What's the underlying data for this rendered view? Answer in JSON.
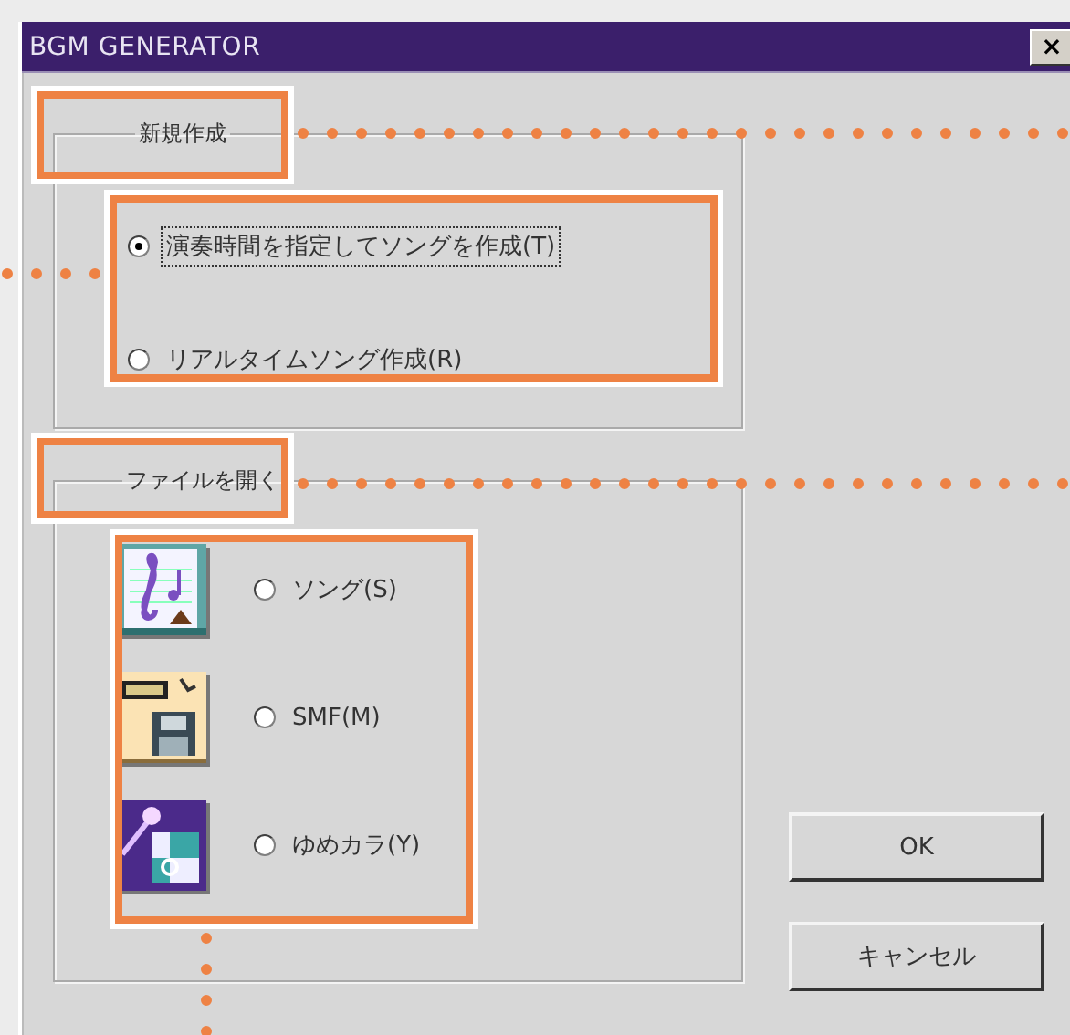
{
  "window": {
    "title": "BGM GENERATOR",
    "close": "×"
  },
  "new_group": {
    "label": "新規作成",
    "options": [
      {
        "label": "演奏時間を指定してソングを作成(T)",
        "selected": true,
        "focused": true
      },
      {
        "label": "リアルタイムソング作成(R)",
        "selected": false,
        "focused": false
      }
    ]
  },
  "open_group": {
    "label": "ファイルを開く",
    "options": [
      {
        "label": "ソング(S)",
        "selected": false,
        "kind": "song"
      },
      {
        "label": "SMF(M)",
        "selected": false,
        "kind": "smf"
      },
      {
        "label": "ゆめカラ(Y)",
        "selected": false,
        "kind": "yumekara"
      }
    ]
  },
  "buttons": [
    "OK",
    "キャンセル"
  ]
}
